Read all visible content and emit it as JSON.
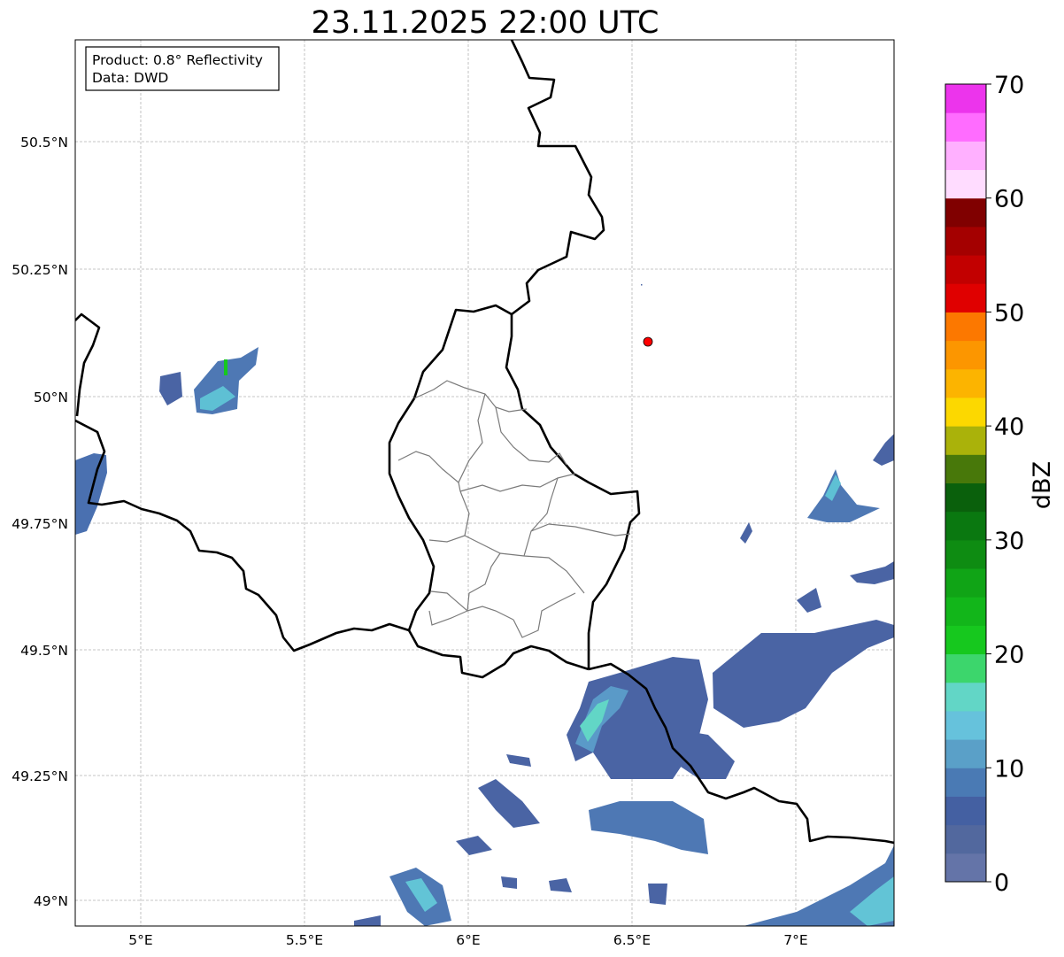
{
  "title": "23.11.2025 22:00 UTC",
  "info": {
    "product": "Product: 0.8° Reflectivity",
    "source": "Data: DWD"
  },
  "map": {
    "lon_range": [
      4.8,
      7.3
    ],
    "lat_range": [
      48.95,
      50.7
    ],
    "lon_ticks": [
      {
        "value": 5.0,
        "label": "5°E"
      },
      {
        "value": 5.5,
        "label": "5.5°E"
      },
      {
        "value": 6.0,
        "label": "6°E"
      },
      {
        "value": 6.5,
        "label": "6.5°E"
      },
      {
        "value": 7.0,
        "label": "7°E"
      }
    ],
    "lat_ticks": [
      {
        "value": 50.5,
        "label": "50.5°N"
      },
      {
        "value": 50.25,
        "label": "50.25°N"
      },
      {
        "value": 50.0,
        "label": "50°N"
      },
      {
        "value": 49.75,
        "label": "49.75°N"
      },
      {
        "value": 49.5,
        "label": "49.5°N"
      },
      {
        "value": 49.25,
        "label": "49.25°N"
      },
      {
        "value": 49.0,
        "label": "49°N"
      }
    ],
    "gridlines": true,
    "marker": {
      "lon": 6.55,
      "lat": 50.105,
      "color": "#ff0000"
    }
  },
  "colorbar": {
    "label": "dBZ",
    "min": 0,
    "max": 70,
    "step": 2.5,
    "tick_values": [
      0,
      10,
      20,
      30,
      40,
      50,
      60,
      70
    ],
    "tick_labels": [
      "0",
      "10",
      "20",
      "30",
      "40",
      "50",
      "60",
      "70"
    ],
    "colors": [
      "#6474a8",
      "#52689e",
      "#4460a2",
      "#4a7ab4",
      "#5aa0c8",
      "#66c2dc",
      "#62d6c6",
      "#3cd66c",
      "#16c81e",
      "#12b61a",
      "#10a416",
      "#0e8c12",
      "#0a7810",
      "#0a600c",
      "#48780a",
      "#aab20a",
      "#fcd800",
      "#fcb400",
      "#fc9600",
      "#fc7800",
      "#e00000",
      "#c20000",
      "#a40000",
      "#800000",
      "#ffdcff",
      "#ffb0ff",
      "#ff6cff",
      "#ec34ec"
    ]
  }
}
